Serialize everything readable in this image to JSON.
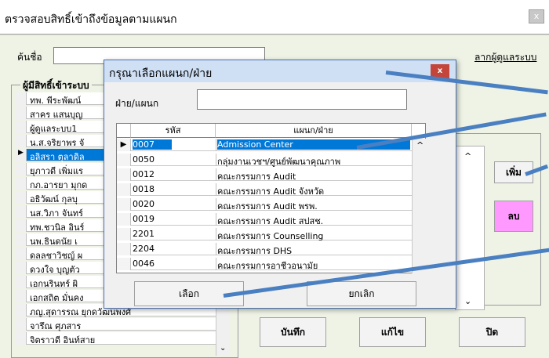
{
  "window": {
    "title": "ตรวจสอบสิทธิ์เข้าถึงข้อมูลตามแผนก",
    "close": "x"
  },
  "form": {
    "search_label": "ค้นชื่อ",
    "search_value": "",
    "link_text": "ลากผู้ดูแลระบบ",
    "list_title": "ผู้มีสิทธิ์เข้าระบบ",
    "users": [
      "ทพ. พีระพัฒน์",
      "สาคร แสนบุญ",
      "ผู้ดูแลระบบ1",
      "น.ส.จริยาพร จั",
      "อลิสรา ตุลาดิล",
      "ยุภาวดี เพิ่มแร",
      "กภ.อารยา มุกด",
      "อธิวัฒน์ กุลบุ",
      "นส.วิภา จันทร์",
      "ทพ.ชวนิล อินร์",
      "นพ.ธินดนัย เ",
      "ดลลชาวิชญ์ ผ",
      "ดวงใจ บุญตัว",
      "เอกนรินทร์ ผิ",
      "เอกสถิต มั่นคง",
      "ภญ.สุดารรณ ยุกดวัฒนพงศ์",
      "จารึณ ศุภสาร",
      "จิตราวดี อินท์สาย"
    ],
    "add_button": "เพิ่ม",
    "delete_button": "ลบ",
    "save_button": "บันทึก",
    "edit_button": "แก้ไข",
    "close_button": "ปิด"
  },
  "dialog": {
    "title": "กรุณาเลือกแผนก/ฝ่าย",
    "close": "x",
    "field_label": "ฝ่าย/แผนก",
    "field_value": "",
    "col_code": "รหัส",
    "col_name": "แผนก/ฝ่าย",
    "rows": [
      {
        "code": "0007",
        "name": "Admission Center"
      },
      {
        "code": "0050",
        "name": "กลุ่มงานเวชฯ/ศูนย์พัฒนาคุณภาพ"
      },
      {
        "code": "0012",
        "name": "คณะกรรมการ Audit"
      },
      {
        "code": "0018",
        "name": "คณะกรรมการ Audit จังหวัด"
      },
      {
        "code": "0020",
        "name": "คณะกรรมการ Audit พรพ."
      },
      {
        "code": "0019",
        "name": "คณะกรรมการ Audit สปสช."
      },
      {
        "code": "2201",
        "name": "คณะกรรมการ Counselling"
      },
      {
        "code": "2204",
        "name": "คณะกรรมการ DHS"
      },
      {
        "code": "0046",
        "name": "คณะกรรมการอาชีวอนามัย"
      }
    ],
    "select_button": "เลือก",
    "cancel_button": "ยกเลิก"
  }
}
